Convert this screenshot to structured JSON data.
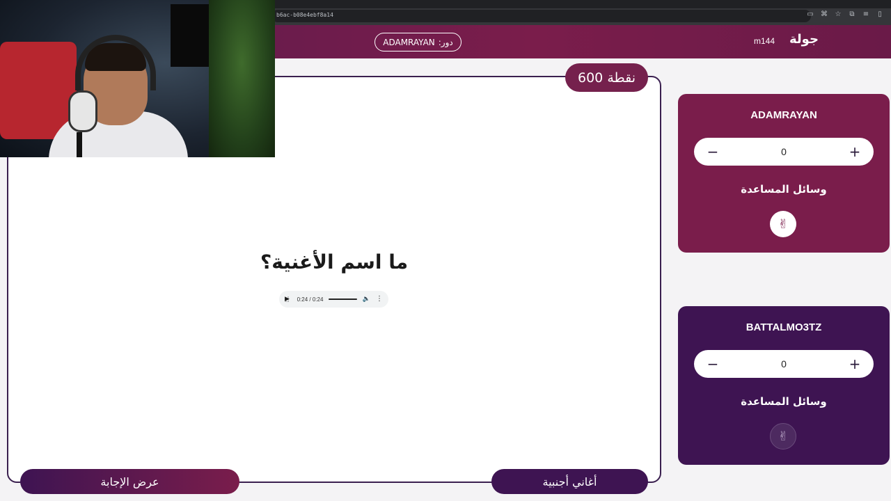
{
  "browser": {
    "url_fragment": "b6ac-b08e4ebf8a14"
  },
  "header": {
    "turn_label": "دور:",
    "turn_player": "ADAMRAYAN",
    "username": "m144",
    "logo": "جولة"
  },
  "question_card": {
    "points": "600 نقطة",
    "question": "ما اسم الأغنية؟",
    "audio": {
      "time": "0:24 / 0:24"
    },
    "answer_button": "عرض الإجابة",
    "category": "أغاني أجنبية"
  },
  "teams": [
    {
      "name": "ADAMRAYAN",
      "score": "0",
      "aids_label": "وسائل المساعدة"
    },
    {
      "name": "BATTALMO3TZ",
      "score": "0",
      "aids_label": "وسائل المساعدة"
    }
  ],
  "colors": {
    "primary": "#7a1d4b",
    "secondary": "#3e1452"
  }
}
